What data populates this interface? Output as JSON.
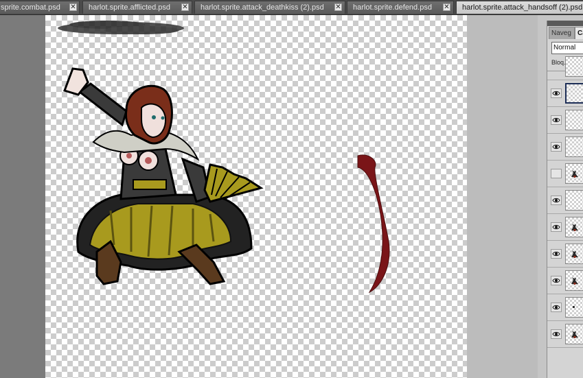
{
  "tabs": [
    {
      "label": "sprite.combat.psd",
      "active": false
    },
    {
      "label": "harlot.sprite.afflicted.psd",
      "active": false
    },
    {
      "label": "harlot.sprite.attack_deathkiss (2).psd",
      "active": false
    },
    {
      "label": "harlot.sprite.defend.psd",
      "active": false
    },
    {
      "label": "harlot.sprite.attack_handsoff (2).psd",
      "active": true
    }
  ],
  "close_glyph": "✕",
  "layers_panel": {
    "tab_navigator": "Naveg",
    "tab_layers": "Ca",
    "blend_mode": "Normal",
    "lock_label": "Bloq.:",
    "layers": [
      {
        "visible": false,
        "thumb": "partial",
        "selected": false
      },
      {
        "visible": true,
        "thumb": "empty",
        "selected": true
      },
      {
        "visible": true,
        "thumb": "empty",
        "selected": false
      },
      {
        "visible": true,
        "thumb": "empty",
        "selected": false
      },
      {
        "visible": false,
        "thumb": "figure",
        "selected": false
      },
      {
        "visible": true,
        "thumb": "empty",
        "selected": false
      },
      {
        "visible": true,
        "thumb": "figure",
        "selected": false
      },
      {
        "visible": true,
        "thumb": "figure",
        "selected": false
      },
      {
        "visible": true,
        "thumb": "figure",
        "selected": false
      },
      {
        "visible": true,
        "thumb": "dot",
        "selected": false
      },
      {
        "visible": true,
        "thumb": "figure",
        "selected": false
      }
    ]
  },
  "colors": {
    "accent_slash": "#7a1518",
    "skirt": "#a89a1e",
    "hair": "#7a2e1a",
    "shadow": "#2a2a2a",
    "selected_border": "#1b2c55"
  }
}
